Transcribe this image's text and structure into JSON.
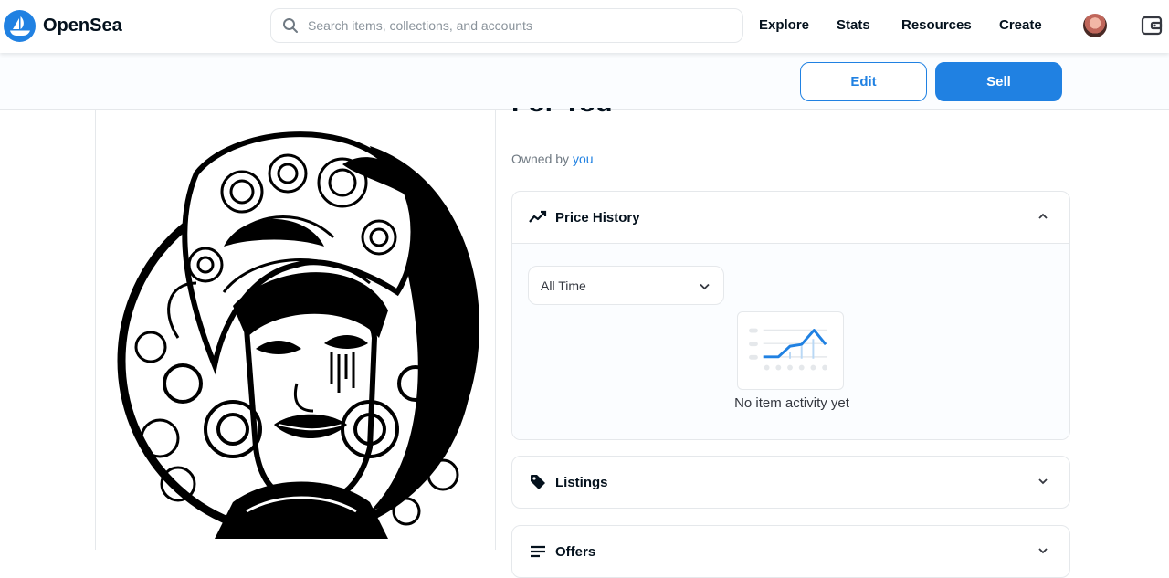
{
  "header": {
    "brand": "OpenSea",
    "search_placeholder": "Search items, collections, and accounts",
    "nav": [
      "Explore",
      "Stats",
      "Resources",
      "Create"
    ]
  },
  "actions": {
    "edit_label": "Edit",
    "sell_label": "Sell"
  },
  "item": {
    "title": "For You",
    "owned_prefix": "Owned by",
    "owner": "you"
  },
  "price_history": {
    "title": "Price History",
    "range_selected": "All Time",
    "empty_text": "No item activity yet"
  },
  "listings": {
    "title": "Listings"
  },
  "offers": {
    "title": "Offers"
  },
  "colors": {
    "accent": "#2081e2",
    "text": "#04111d",
    "muted": "#707a83",
    "border": "#e5e8eb"
  }
}
